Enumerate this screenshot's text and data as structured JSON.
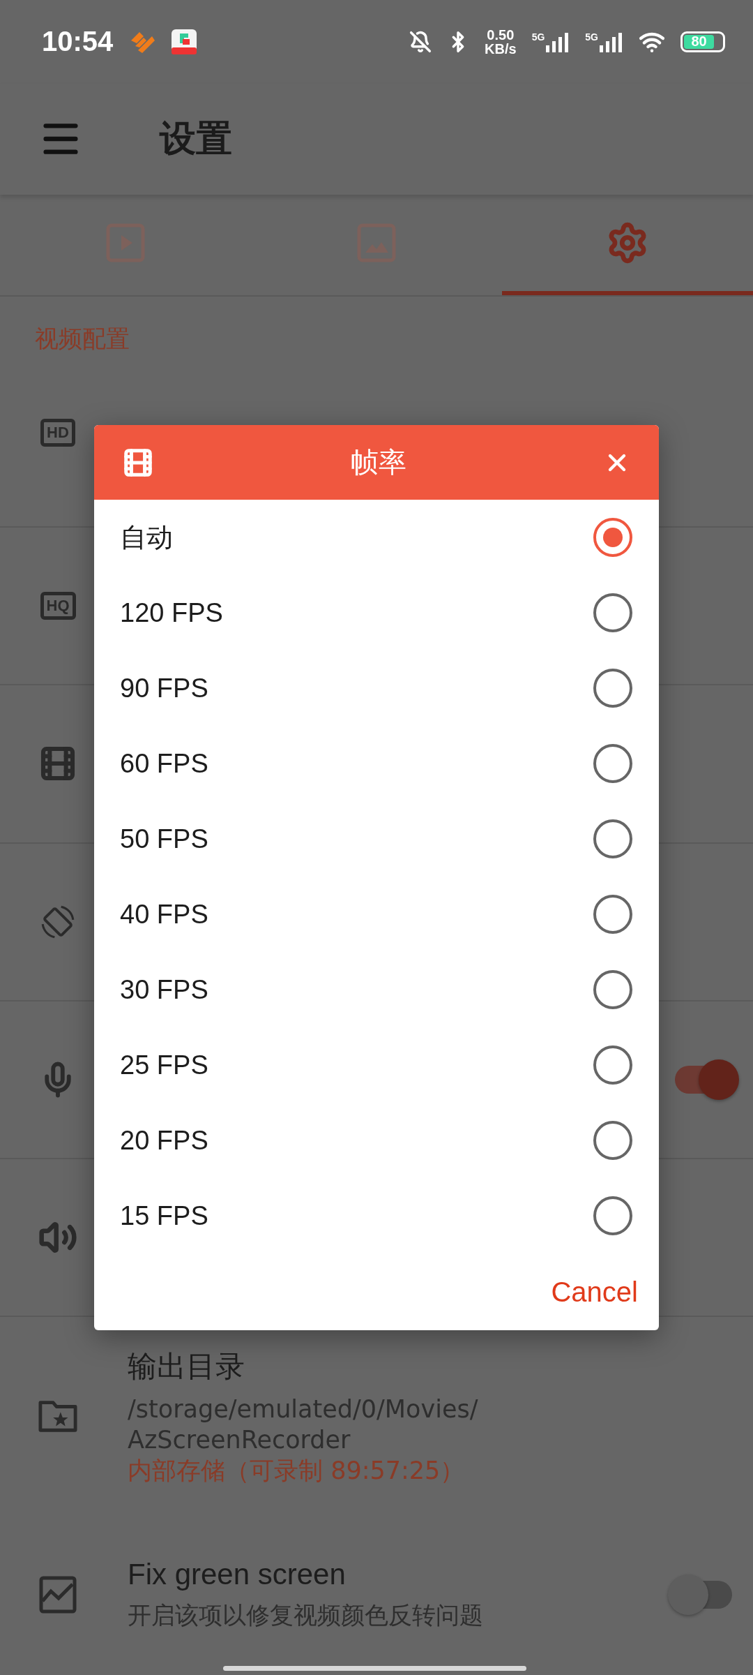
{
  "status_bar": {
    "time": "10:54",
    "net_speed": [
      "0.50",
      "KB/s"
    ],
    "signal_labels": [
      "5G",
      "5G"
    ],
    "battery": "80"
  },
  "app_bar": {
    "title": "设置"
  },
  "tabs": [
    {
      "kind": "video",
      "selected": false
    },
    {
      "kind": "image",
      "selected": false
    },
    {
      "kind": "settings",
      "selected": true
    }
  ],
  "section": {
    "title": "视频配置"
  },
  "settings": [
    {
      "kind": "resolution",
      "badge": "HD"
    },
    {
      "kind": "quality",
      "badge": "HQ"
    },
    {
      "kind": "framerate"
    },
    {
      "kind": "orientation"
    },
    {
      "kind": "audio",
      "on": true
    },
    {
      "kind": "speaker"
    },
    {
      "kind": "folder",
      "title": "输出目录",
      "value_lines": [
        "/storage/emulated/0/Movies/",
        "AzScreenRecorder"
      ],
      "note": "内部存储（可录制 89:57:25）"
    },
    {
      "kind": "fix",
      "title": "Fix green screen",
      "description": "开启该项以修复视频颜色反转问题",
      "on": false
    }
  ],
  "dialog": {
    "title": "帧率",
    "options": [
      {
        "label": "自动",
        "selected": true
      },
      {
        "label": "120 FPS",
        "selected": false
      },
      {
        "label": "90 FPS",
        "selected": false
      },
      {
        "label": "60 FPS",
        "selected": false
      },
      {
        "label": "50 FPS",
        "selected": false
      },
      {
        "label": "40 FPS",
        "selected": false
      },
      {
        "label": "30 FPS",
        "selected": false
      },
      {
        "label": "25 FPS",
        "selected": false
      },
      {
        "label": "20 FPS",
        "selected": false
      },
      {
        "label": "15 FPS",
        "selected": false
      }
    ],
    "cancel": "Cancel"
  }
}
